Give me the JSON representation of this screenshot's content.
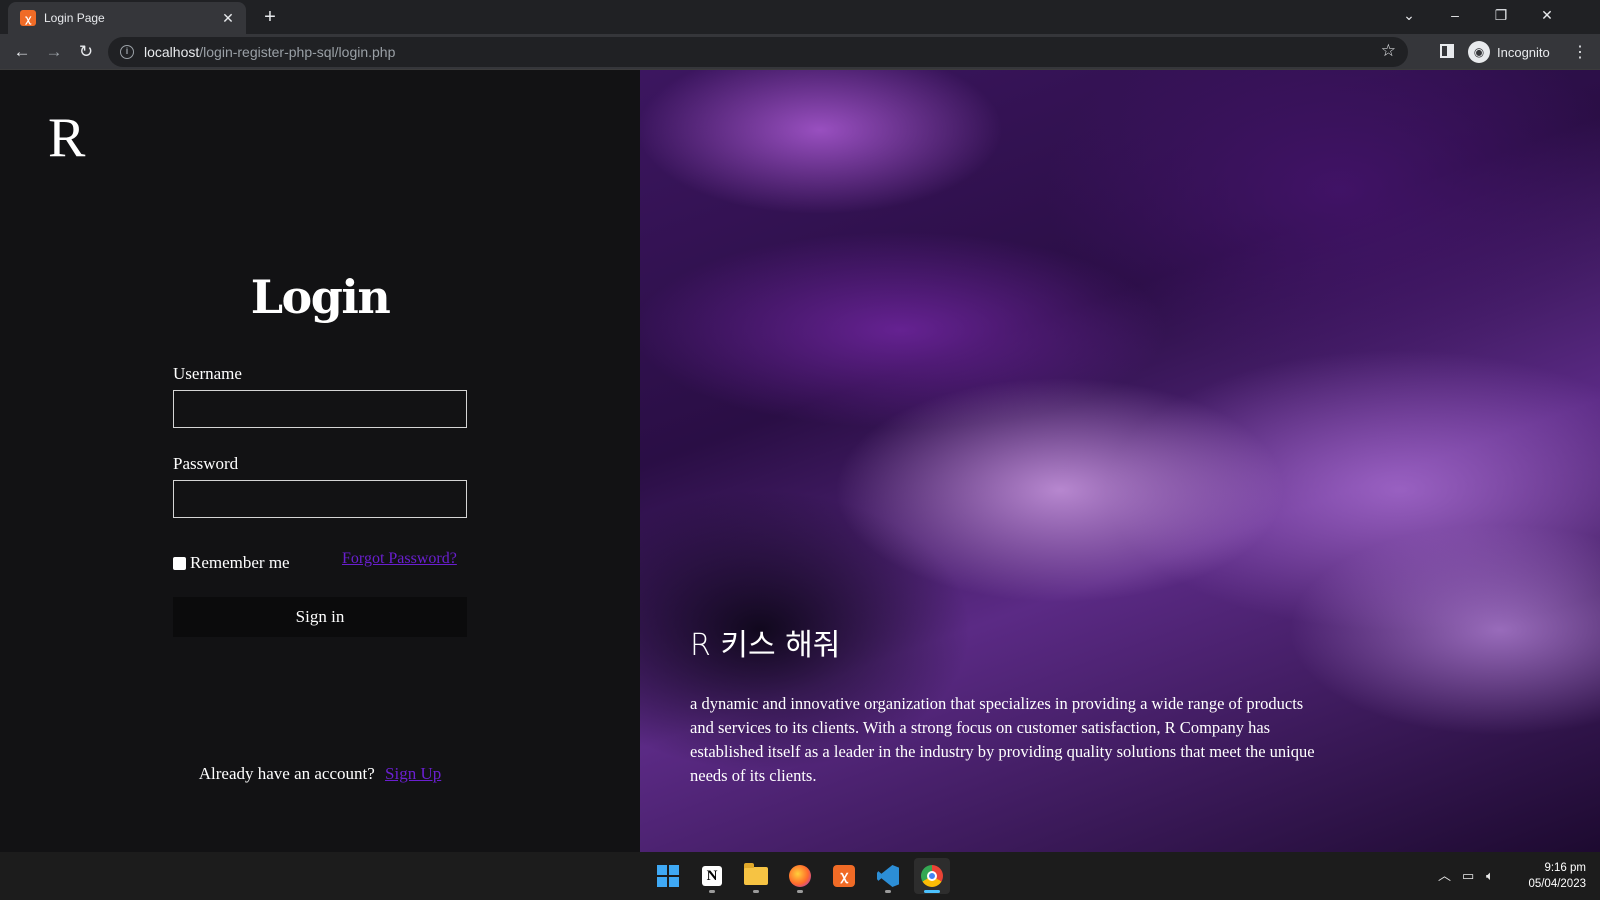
{
  "browser": {
    "tab_title": "Login Page",
    "tab_favicon": "xampp-icon",
    "url_host": "localhost",
    "url_path": "/login-register-php-sql/login.php",
    "profile_label": "Incognito"
  },
  "login": {
    "logo_text": "R",
    "title": "Login",
    "username_label": "Username",
    "username_value": "",
    "password_label": "Password",
    "password_value": "",
    "remember_label": "Remember me",
    "remember_checked": false,
    "forgot_link": "Forgot Password?",
    "signin_label": "Sign in",
    "account_prompt": "Already have an account?",
    "signup_link": "Sign Up"
  },
  "hero": {
    "title": "R 키스 해줘",
    "description": "a dynamic and innovative organization that specializes in providing a wide range of products and services to its clients. With a strong focus on customer satisfaction, R Company has established itself as a leader in the industry by providing quality solutions that meet the unique needs of its clients."
  },
  "taskbar": {
    "apps": [
      "start-windows",
      "notion",
      "file-explorer",
      "firefox",
      "xampp",
      "vscode",
      "chrome"
    ],
    "active_app": "chrome",
    "time": "9:16 pm",
    "date": "05/04/2023"
  },
  "colors": {
    "link": "#6a1fd0",
    "page_bg": "#121214",
    "button_bg": "#0b0b0c"
  }
}
